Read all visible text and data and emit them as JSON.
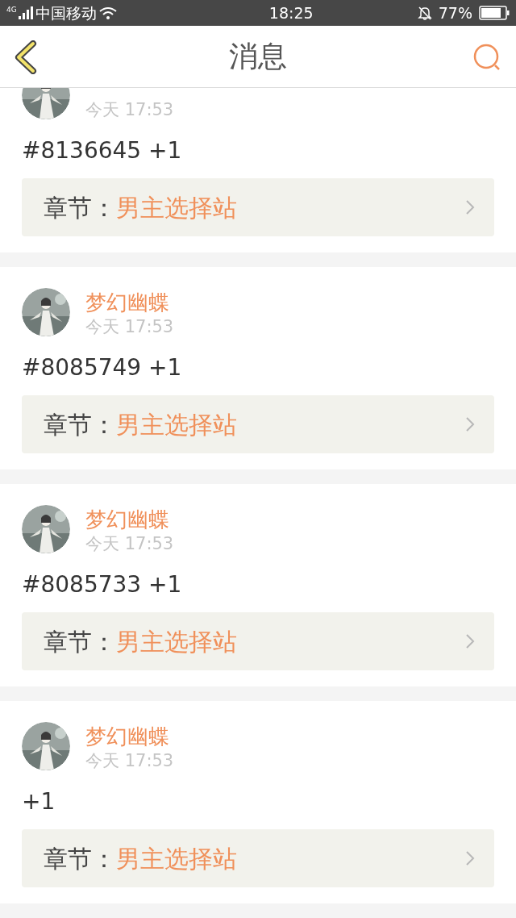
{
  "status_bar": {
    "network": "4G",
    "carrier": "中国移动",
    "time": "18:25",
    "battery": "77%"
  },
  "header": {
    "title": "消息"
  },
  "messages": [
    {
      "time": "今天 17:53",
      "text": "#8136645 +1",
      "chapter_label": "章节：",
      "chapter": "男主选择站"
    },
    {
      "name": "梦幻幽蝶",
      "time": "今天 17:53",
      "text": "#8085749 +1",
      "chapter_label": "章节：",
      "chapter": "男主选择站"
    },
    {
      "name": "梦幻幽蝶",
      "time": "今天 17:53",
      "text": "#8085733 +1",
      "chapter_label": "章节：",
      "chapter": "男主选择站"
    },
    {
      "name": "梦幻幽蝶",
      "time": "今天 17:53",
      "text": "+1",
      "chapter_label": "章节：",
      "chapter": "男主选择站"
    }
  ]
}
